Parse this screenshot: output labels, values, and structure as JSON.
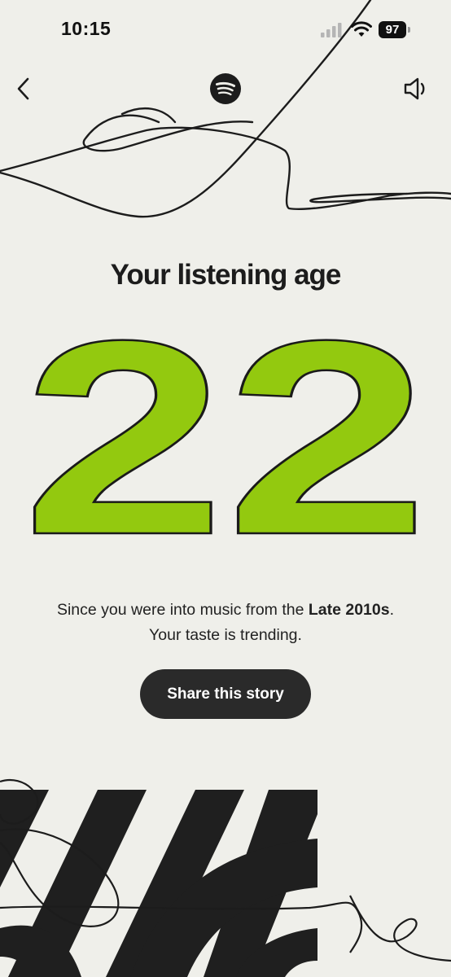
{
  "status_bar": {
    "time": "10:15",
    "battery": "97"
  },
  "header": {
    "logo_icon": "spotify-logo",
    "back_icon": "chevron-left-icon",
    "sound_icon": "speaker-icon"
  },
  "story": {
    "title": "Your listening age",
    "age": "22",
    "caption_prefix": "Since you were into music from the ",
    "caption_era": "Late 2010s",
    "caption_suffix": ".",
    "caption_line2": "Your taste is trending.",
    "share_label": "Share this story"
  },
  "colors": {
    "background": "#efefea",
    "accent_green": "#93c90f",
    "dark": "#1f1f1f"
  }
}
